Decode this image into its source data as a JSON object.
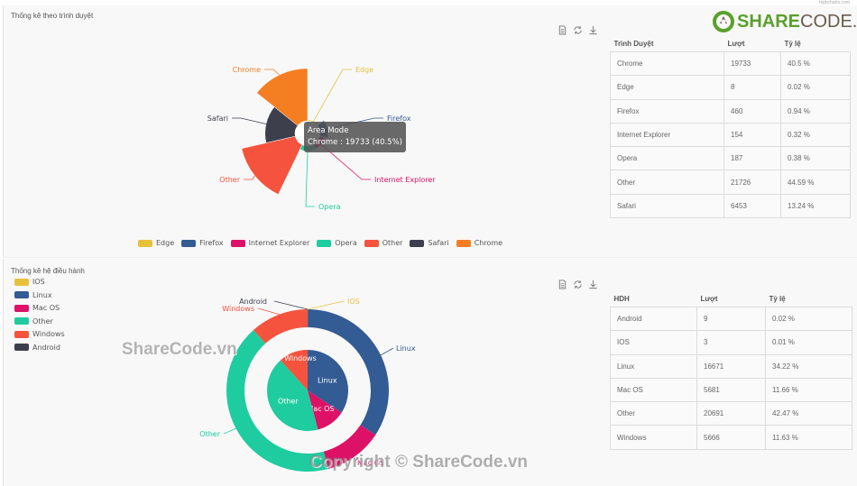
{
  "credit": "highcharts.com",
  "logo": {
    "share": "SHARE",
    "code": "CODE.vn"
  },
  "watermarks": {
    "center": "ShareCode.vn",
    "bottom": "Copyright © ShareCode.vn"
  },
  "toolbox": {
    "items": [
      "data-view",
      "restore",
      "save-as-image"
    ]
  },
  "browser_panel": {
    "title": "Thống kê theo trình duyệt",
    "tooltip": {
      "title": "Area Mode",
      "text": "Chrome : 19733 (40.5%)"
    },
    "table": {
      "headers": [
        "Trình Duyệt",
        "Lượt",
        "Tỷ lệ"
      ],
      "rows": [
        [
          "Chrome",
          "19733",
          "40.5 %"
        ],
        [
          "Edge",
          "8",
          "0.02 %"
        ],
        [
          "Firefox",
          "460",
          "0.94 %"
        ],
        [
          "Internet Explorer",
          "154",
          "0.32 %"
        ],
        [
          "Opera",
          "187",
          "0.38 %"
        ],
        [
          "Other",
          "21726",
          "44.59 %"
        ],
        [
          "Safari",
          "6453",
          "13.24 %"
        ]
      ]
    }
  },
  "os_panel": {
    "title": "Thống kê hệ điều hành",
    "table": {
      "headers": [
        "HDH",
        "Lượt",
        "Tỷ lệ"
      ],
      "rows": [
        [
          "Android",
          "9",
          "0.02 %"
        ],
        [
          "IOS",
          "3",
          "0.01 %"
        ],
        [
          "Linux",
          "16671",
          "34.22 %"
        ],
        [
          "Mac OS",
          "5681",
          "11.66 %"
        ],
        [
          "Other",
          "20691",
          "42.47 %"
        ],
        [
          "Windows",
          "5666",
          "11.63 %"
        ]
      ]
    }
  },
  "chart_data": [
    {
      "type": "pie",
      "subtype": "nightingale-rose-area",
      "title": "Thống kê theo trình duyệt",
      "legend_position": "bottom-center",
      "categories": [
        "Edge",
        "Firefox",
        "Internet Explorer",
        "Opera",
        "Other",
        "Safari",
        "Chrome"
      ],
      "values": [
        8,
        460,
        154,
        187,
        21726,
        6453,
        19733
      ],
      "colors": [
        "#e8c13c",
        "#335b94",
        "#dd1166",
        "#1ecc9f",
        "#f5533d",
        "#3d3f4d",
        "#f57e22"
      ],
      "highlighted": "Chrome"
    },
    {
      "type": "pie",
      "subtype": "nested-donut",
      "title": "Thống kê hệ điều hành",
      "legend_position": "top-left",
      "categories": [
        "IOS",
        "Linux",
        "Mac OS",
        "Other",
        "Windows",
        "Android"
      ],
      "legend_order": [
        "IOS",
        "Linux",
        "Mac OS",
        "Other",
        "Windows",
        "Android"
      ],
      "inner_series": {
        "name": "inner",
        "values": [
          3,
          16671,
          5681,
          20691,
          5666,
          9
        ]
      },
      "outer_series": {
        "name": "outer",
        "values": [
          3,
          16671,
          5681,
          20691,
          5666,
          9
        ]
      },
      "colors": [
        "#e8c13c",
        "#335b94",
        "#dd1166",
        "#1ecc9f",
        "#f5533d",
        "#3d3f4d"
      ]
    }
  ]
}
